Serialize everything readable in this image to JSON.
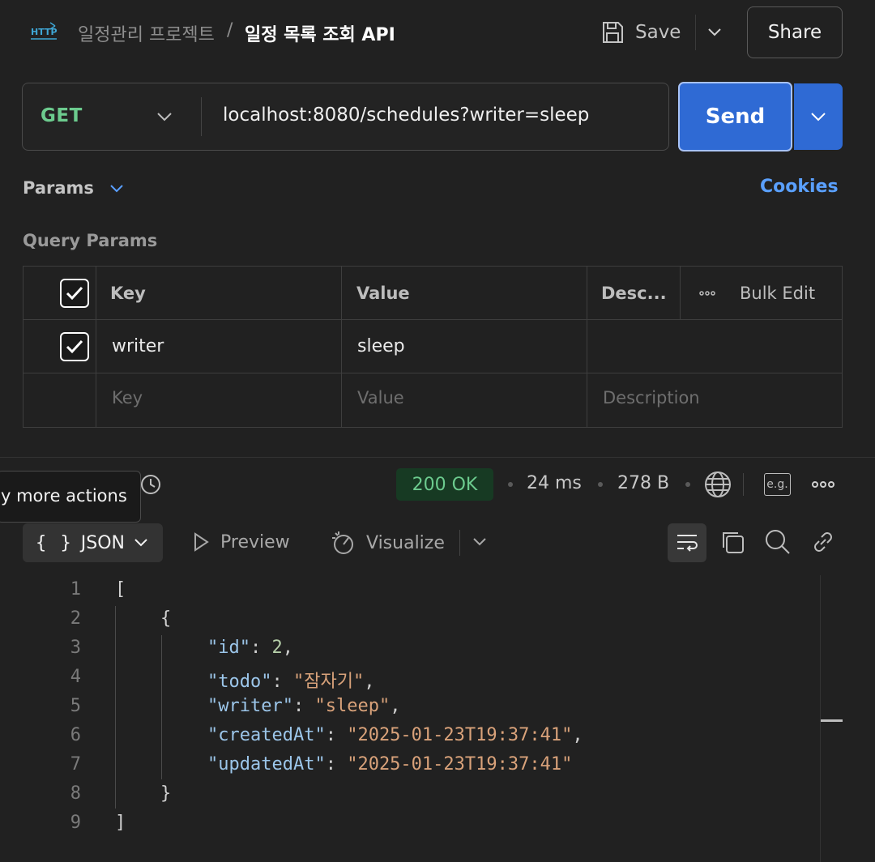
{
  "header": {
    "breadcrumb_parent": "일정관리 프로젝트",
    "breadcrumb_separator": "/",
    "breadcrumb_current": "일정 목록 조회 API",
    "save_label": "Save",
    "share_label": "Share",
    "icon": "http-icon"
  },
  "request": {
    "method": "GET",
    "url": "localhost:8080/schedules?writer=sleep",
    "send_label": "Send"
  },
  "params": {
    "section_label": "Params",
    "cookies_label": "Cookies",
    "query_params_label": "Query Params",
    "columns": [
      "Key",
      "Value",
      "Desc...",
      "Bulk Edit"
    ],
    "rows": [
      {
        "checked": true,
        "key": "writer",
        "value": "sleep",
        "description": ""
      }
    ],
    "placeholder": {
      "key": "Key",
      "value": "Value",
      "description": "Description"
    }
  },
  "response": {
    "tooltip": "y more actions",
    "status": "200 OK",
    "time": "24 ms",
    "size": "278 B",
    "eg_label": "e.g.",
    "tabs": {
      "json": "JSON",
      "json_brace": "{ }",
      "preview": "Preview",
      "visualize": "Visualize"
    },
    "line_numbers": [
      "1",
      "2",
      "3",
      "4",
      "5",
      "6",
      "7",
      "8",
      "9"
    ],
    "body": {
      "open_array": "[",
      "open_obj": "{",
      "fields": [
        {
          "key": "\"id\"",
          "value": "2",
          "type": "number",
          "comma": ","
        },
        {
          "key": "\"todo\"",
          "value": "\"잠자기\"",
          "type": "string",
          "comma": ","
        },
        {
          "key": "\"writer\"",
          "value": "\"sleep\"",
          "type": "string",
          "comma": ","
        },
        {
          "key": "\"createdAt\"",
          "value": "\"2025-01-23T19:37:41\"",
          "type": "string",
          "comma": ","
        },
        {
          "key": "\"updatedAt\"",
          "value": "\"2025-01-23T19:37:41\"",
          "type": "string",
          "comma": ""
        }
      ],
      "close_obj": "}",
      "close_array": "]"
    }
  },
  "colors": {
    "background": "#212121",
    "accent": "#2f6ad4",
    "method_get": "#6ccb8e",
    "link": "#5aa0ff",
    "status_ok_bg": "#173a23"
  }
}
